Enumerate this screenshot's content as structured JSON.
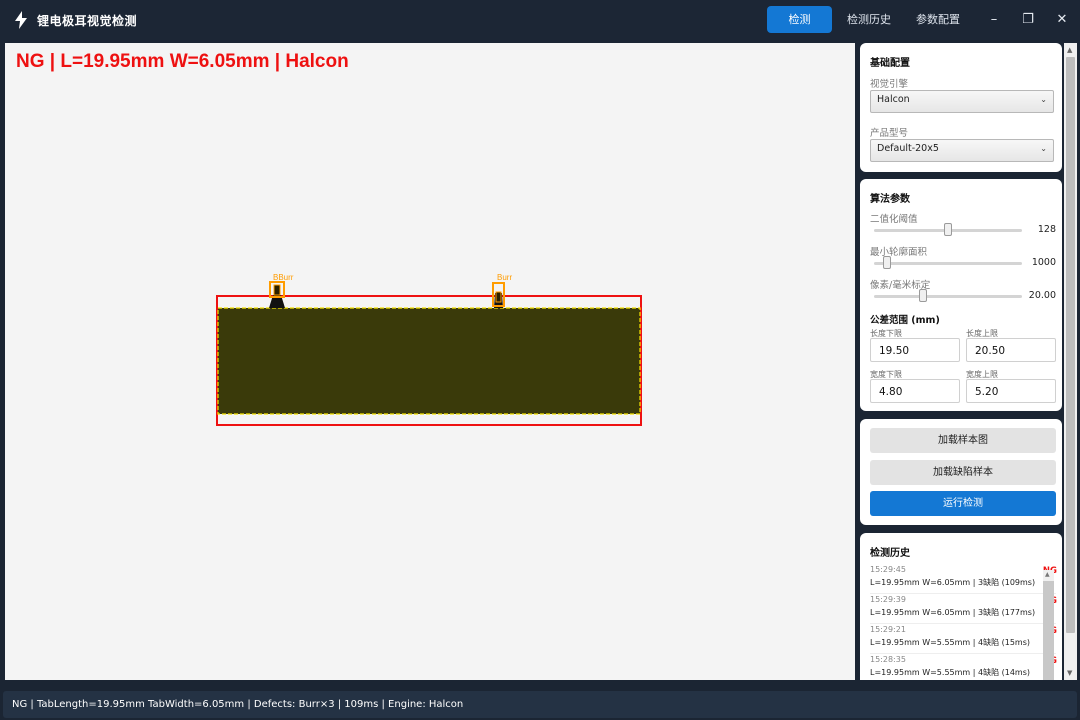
{
  "app": {
    "title": "锂电极耳视觉检测",
    "icon": "lightning-icon"
  },
  "nav": {
    "tabs": [
      {
        "label": "检测",
        "active": true
      },
      {
        "label": "检测历史",
        "active": false
      },
      {
        "label": "参数配置",
        "active": false
      }
    ]
  },
  "window_controls": {
    "minimize": "–",
    "maximize": "❐",
    "close": "✕"
  },
  "canvas": {
    "result_text": "NG | L=19.95mm W=6.05mm | Halcon",
    "defect_labels": [
      "BBurr",
      "Burr"
    ],
    "colors": {
      "tab_fill": "#3a3a0a",
      "ng_box": "#ee1111",
      "contour": "#f5e400",
      "defect_box": "#ff9c00"
    }
  },
  "basic_config": {
    "title": "基础配置",
    "engine_label": "视觉引擎",
    "engine_value": "Halcon",
    "model_label": "产品型号",
    "model_value": "Default-20x5"
  },
  "algo_params": {
    "title": "算法参数",
    "sliders": [
      {
        "label": "二值化阈值",
        "value": "128",
        "fraction": 0.5
      },
      {
        "label": "最小轮廓面积",
        "value": "1000",
        "fraction": 0.09
      },
      {
        "label": "像素/毫米标定",
        "value": "20.00",
        "fraction": 0.33
      }
    ],
    "tolerance_title": "公差范围 (mm)",
    "tolerance": {
      "len_min_label": "长度下限",
      "len_min": "19.50",
      "len_max_label": "长度上限",
      "len_max": "20.50",
      "wid_min_label": "宽度下限",
      "wid_min": "4.80",
      "wid_max_label": "宽度上限",
      "wid_max": "5.20"
    }
  },
  "actions": {
    "load_sample": "加载样本图",
    "load_defect": "加载缺陷样本",
    "run": "运行检测"
  },
  "history": {
    "title": "检测历史",
    "items": [
      {
        "time": "15:29:45",
        "detail": "L=19.95mm  W=6.05mm | 3缺陷 (109ms)",
        "status": "NG"
      },
      {
        "time": "15:29:39",
        "detail": "L=19.95mm  W=6.05mm | 3缺陷 (177ms)",
        "status": "NG"
      },
      {
        "time": "15:29:21",
        "detail": "L=19.95mm  W=5.55mm | 4缺陷 (15ms)",
        "status": "NG"
      },
      {
        "time": "15:28:35",
        "detail": "L=19.95mm  W=5.55mm | 4缺陷 (14ms)",
        "status": "NG"
      }
    ]
  },
  "status_bar": {
    "text": "NG | TabLength=19.95mm  TabWidth=6.05mm | Defects: Burr×3 | 109ms | Engine: Halcon"
  }
}
